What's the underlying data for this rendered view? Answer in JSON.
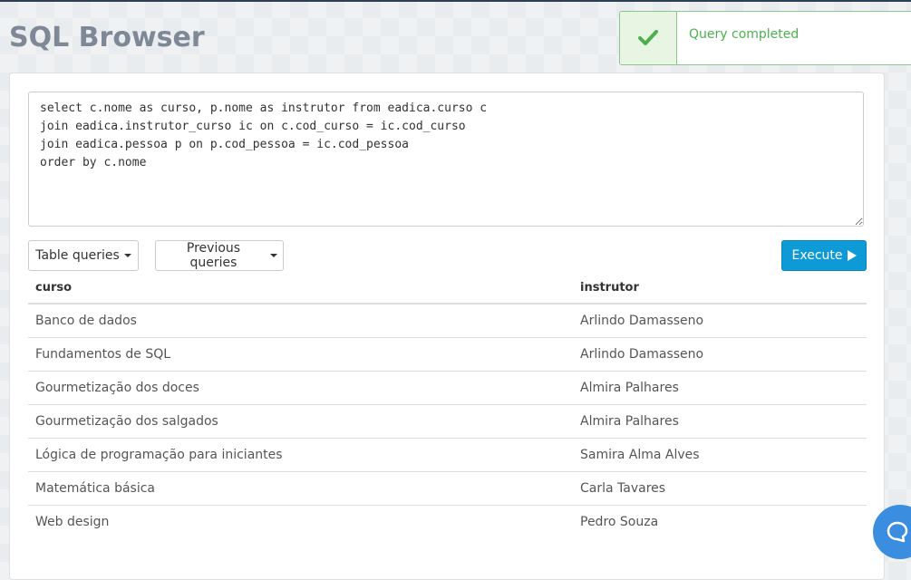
{
  "app": {
    "title": "SQL Browser"
  },
  "toast": {
    "message": "Query completed",
    "status": "success",
    "color": "#4caf50"
  },
  "editor": {
    "query": "select c.nome as curso, p.nome as instrutor from eadica.curso c\njoin eadica.instrutor_curso ic on c.cod_curso = ic.cod_curso\njoin eadica.pessoa p on p.cod_pessoa = ic.cod_pessoa\norder by c.nome"
  },
  "toolbar": {
    "table_queries_label": "Table queries",
    "previous_queries_label": "Previous queries",
    "execute_label": "Execute"
  },
  "results": {
    "columns": [
      "curso",
      "instrutor"
    ],
    "rows": [
      [
        "Banco de dados",
        "Arlindo Damasseno"
      ],
      [
        "Fundamentos de SQL",
        "Arlindo Damasseno"
      ],
      [
        "Gourmetização dos doces",
        "Almira Palhares"
      ],
      [
        "Gourmetização dos salgados",
        "Almira Palhares"
      ],
      [
        "Lógica de programação para iniciantes",
        "Samira Alma Alves"
      ],
      [
        "Matemática básica",
        "Carla Tavares"
      ],
      [
        "Web design",
        "Pedro Souza"
      ]
    ]
  },
  "colors": {
    "accent": "#0e9ad6",
    "success": "#4caf50",
    "chat": "#3b8de0"
  },
  "icons": {
    "toast": "check-icon",
    "execute": "play-icon",
    "chat": "chat-icon"
  }
}
